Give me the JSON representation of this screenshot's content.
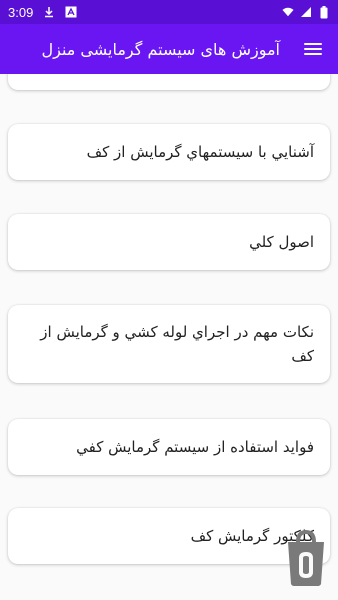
{
  "status_bar": {
    "time": "3:09",
    "icons": [
      "download-icon",
      "app-notification-icon",
      "wifi-icon",
      "signal-icon",
      "battery-icon"
    ]
  },
  "app_bar": {
    "title": "آموزش های سیستم گرمایشی منزل",
    "menu_icon": "hamburger-menu-icon"
  },
  "colors": {
    "status_bar": "#5a10d4",
    "app_bar": "#6a16f2",
    "background": "#fafafa",
    "card": "#ffffff",
    "fab_icon": "#7a7a7a"
  },
  "list": {
    "items": [
      {
        "label": ""
      },
      {
        "label": "آشنايي با سيستمهاي گرمايش از كف"
      },
      {
        "label": "اصول كلي"
      },
      {
        "label": "نكات مهم در اجراي لوله كشي و گرمايش از كف"
      },
      {
        "label": "فوايد استفاده از سيستم گرمايش كفي"
      },
      {
        "label": "كلكتور گرمايش كف"
      }
    ]
  },
  "fab": {
    "icon": "bazaar-shopping-bag-icon"
  }
}
